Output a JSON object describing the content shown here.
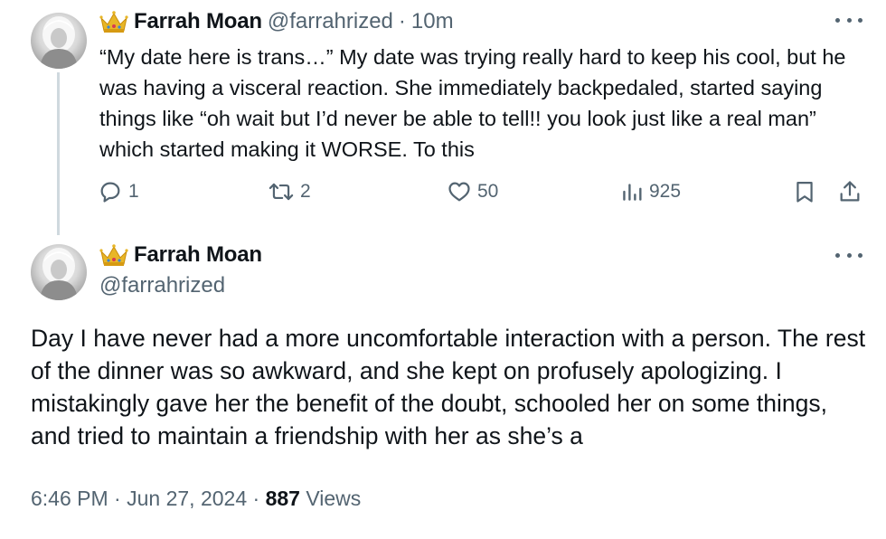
{
  "tweets": [
    {
      "display_name": "Farrah Moan",
      "handle": "@farrahrized",
      "separator": "·",
      "time": "10m",
      "text": "“My date here is trans…” My date was trying really hard to keep his cool, but he was having a visceral reaction. She immediately backpedaled, started saying things like “oh wait but I’d never be able to tell!! you look just like a real man” which started making it WORSE. To this",
      "actions": {
        "replies": "1",
        "reposts": "2",
        "likes": "50",
        "views": "925"
      },
      "icons": {
        "badge": "crown-emoji",
        "reply": "speech-bubble-icon",
        "repost": "repost-arrows-icon",
        "like": "heart-icon",
        "views": "bar-chart-icon",
        "bookmark": "bookmark-icon",
        "share": "share-arrow-icon",
        "more": "ellipsis-icon"
      }
    },
    {
      "display_name": "Farrah Moan",
      "handle": "@farrahrized",
      "text": "Day I have never had a more uncomfortable interaction with a person. The rest of the dinner was so awkward, and she kept on profusely apologizing. I mistakingly gave her the benefit of the doubt, schooled her on some things, and tried to maintain a friendship with her as she’s a",
      "footer": {
        "time": "6:46 PM",
        "sep1": "·",
        "date": "Jun 27, 2024",
        "sep2": "·",
        "views_count": "887",
        "views_label": "Views"
      }
    }
  ],
  "colors": {
    "text": "#0f1419",
    "secondary": "#536471",
    "thread_line": "#cfd9de",
    "crown": "#e8b627"
  }
}
